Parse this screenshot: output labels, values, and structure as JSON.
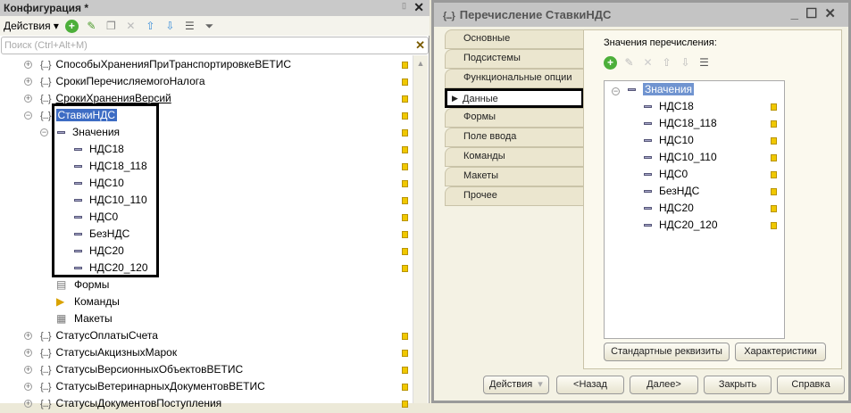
{
  "config": {
    "title": "Конфигурация *",
    "actions_label": "Действия",
    "search_placeholder": "Поиск (Ctrl+Alt+M)",
    "tree": [
      {
        "label": "СпособыХраненияПриТранспортировкеВЕТИС"
      },
      {
        "label": "СрокиПеречисляемогоНалога"
      },
      {
        "label": "СрокиХраненияВерсий"
      },
      {
        "label": "СтавкиНДС",
        "expanded": true,
        "selected": true
      }
    ],
    "values_label": "Значения",
    "values": [
      "НДС18",
      "НДС18_118",
      "НДС10",
      "НДС10_110",
      "НДС0",
      "БезНДС",
      "НДС20",
      "НДС20_120"
    ],
    "sub": [
      "Формы",
      "Команды",
      "Макеты"
    ],
    "tree_after": [
      "СтатусОплатыСчета",
      "СтатусыАкцизныхМарок",
      "СтатусыВерсионныхОбъектовВЕТИС",
      "СтатусыВетеринарныхДокументовВЕТИС",
      "СтатусыДокументовПоступления"
    ]
  },
  "dialog": {
    "title": "Перечисление СтавкиНДС",
    "tabs": [
      "Основные",
      "Подсистемы",
      "Функциональные опции",
      "Данные",
      "Формы",
      "Поле ввода",
      "Команды",
      "Макеты",
      "Прочее"
    ],
    "active_tab": "Данные",
    "list_label": "Значения перечисления:",
    "root": "Значения",
    "values": [
      "НДС18",
      "НДС18_118",
      "НДС10",
      "НДС10_110",
      "НДС0",
      "БезНДС",
      "НДС20",
      "НДС20_120"
    ],
    "std_button": "Стандартные реквизиты",
    "char_button": "Характеристики",
    "footer": {
      "actions": "Действия",
      "back": "<Назад",
      "next": "Далее>",
      "close": "Закрыть",
      "help": "Справка"
    }
  }
}
